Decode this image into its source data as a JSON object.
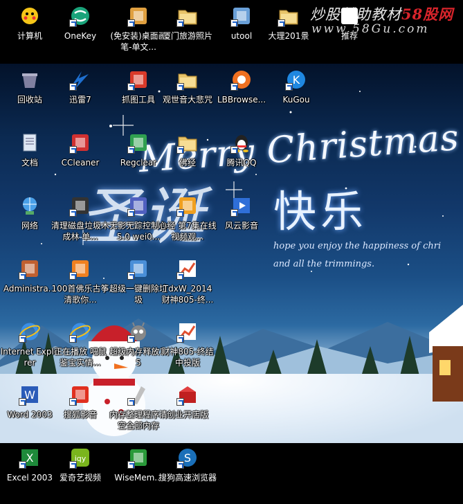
{
  "watermark": {
    "line1_prefix": "炒股輔助教材",
    "line1_red": "58股网",
    "line2": "www.58Gu.com"
  },
  "wallpaper": {
    "title": "Merry Christmas",
    "cn_title_big": "圣诞",
    "cn_title": "快乐",
    "subtitle_1": "hope you enjoy the happiness of chri",
    "subtitle_2": "and all the trimmings."
  },
  "icons": [
    {
      "label": "计算机",
      "icon": "computer-icon",
      "color": "#f5c518"
    },
    {
      "label": "OneKey",
      "icon": "onekey-icon",
      "color": "#1aa37a"
    },
    {
      "label": "(免安装)桌面画笔-单文...",
      "icon": "paint-icon",
      "color": "#e0a040"
    },
    {
      "label": "厦门旅游照片",
      "icon": "folder-icon",
      "color": "#e8c46a"
    },
    {
      "label": "utool",
      "icon": "utool-icon",
      "color": "#6aa0d8"
    },
    {
      "label": "大理201景",
      "icon": "folder-icon",
      "color": "#e8c46a"
    },
    {
      "label": "推荐",
      "icon": "recommend-icon",
      "color": "#ffffff"
    },
    {
      "label": "回收站",
      "icon": "recycle-bin-icon",
      "color": "#8080a0"
    },
    {
      "label": "迅雷7",
      "icon": "thunder-icon",
      "color": "#1e6fd0"
    },
    {
      "label": "抓图工具",
      "icon": "screenshot-icon",
      "color": "#d93a2a"
    },
    {
      "label": "观世音大悲咒",
      "icon": "folder-icon",
      "color": "#e8c46a"
    },
    {
      "label": "LBBrowse...",
      "icon": "browser-icon",
      "color": "#f07020"
    },
    {
      "label": "KuGou",
      "icon": "kugou-icon",
      "color": "#1f87e0"
    },
    {
      "label": "文档",
      "icon": "document-icon",
      "color": "#dfe8f5"
    },
    {
      "label": "CCleaner",
      "icon": "ccleaner-icon",
      "color": "#d03030"
    },
    {
      "label": "Regclear",
      "icon": "regclear-icon",
      "color": "#30a050"
    },
    {
      "label": "佛经",
      "icon": "folder-icon",
      "color": "#e8c46a"
    },
    {
      "label": "腾讯QQ",
      "icon": "qq-icon",
      "color": "#f0c020"
    },
    {
      "label": "网络",
      "icon": "network-icon",
      "color": "#4aa0e8"
    },
    {
      "label": "清理磁盘垃圾木成林 单...",
      "icon": "cleaner-icon",
      "color": "#333333"
    },
    {
      "label": "无影无踪控制台5.0 wei0...",
      "icon": "console-icon",
      "color": "#5060c0"
    },
    {
      "label": "心经 第7集在线视频观...",
      "icon": "video-icon",
      "color": "#f0a020"
    },
    {
      "label": "风云影音",
      "icon": "player-icon",
      "color": "#2f6fd8"
    },
    {
      "label": "Administra...",
      "icon": "user-folder-icon",
      "color": "#c06030"
    },
    {
      "label": "100首佛乐古筝 清歌你...",
      "icon": "music-icon",
      "color": "#f08020"
    },
    {
      "label": "超级一键删除垃圾",
      "icon": "delete-icon",
      "color": "#4a8fd8"
    },
    {
      "label": "TdxW_2014 财神805-终...",
      "icon": "stock-icon",
      "color": "#e05030"
    },
    {
      "label": "Internet Explorer",
      "icon": "ie-icon",
      "color": "#3a8ee6"
    },
    {
      "label": "正在播放 吧鼠鉴宝实情...",
      "icon": "ie-page-icon",
      "color": "#3a8ee6"
    },
    {
      "label": "超级内存释放1.5",
      "icon": "memory-icon",
      "color": "#888888"
    },
    {
      "label": "财神805-终结中投版",
      "icon": "stock-icon",
      "color": "#e05030"
    },
    {
      "label": "Word 2003",
      "icon": "word-icon",
      "color": "#2a5bb8"
    },
    {
      "label": "搜狐影音",
      "icon": "sohu-icon",
      "color": "#e03020"
    },
    {
      "label": "内存整理程序清空全部内存",
      "icon": "rocket-icon",
      "color": "#c0c0c0"
    },
    {
      "label": "创业开店版",
      "icon": "shop-icon",
      "color": "#c02020"
    },
    {
      "label": "Excel 2003",
      "icon": "excel-icon",
      "color": "#1e8a3a"
    },
    {
      "label": "爱奇艺视频",
      "icon": "iqiyi-icon",
      "color": "#7ab51d"
    },
    {
      "label": "WiseMem...",
      "icon": "wisemem-icon",
      "color": "#2a9a3a"
    },
    {
      "label": "搜狗高速浏览器",
      "icon": "sogou-icon",
      "color": "#1a6fb8"
    }
  ]
}
